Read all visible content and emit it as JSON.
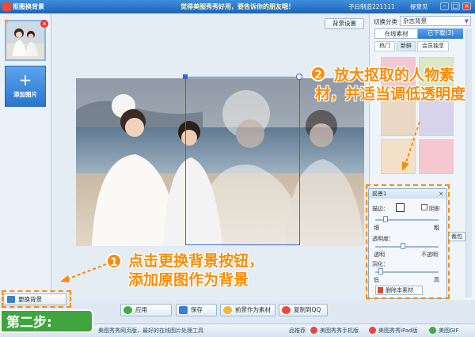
{
  "window": {
    "title": "抠图换背景",
    "slogan": "觉得美图秀秀好用，要告诉你的朋友哦！",
    "user": "子曰制造221111",
    "tip": "提意见",
    "controls": {
      "minimize": "–",
      "maximize": "□",
      "close": "×"
    }
  },
  "left_panel": {
    "add_label": "添加图片",
    "add_plus": "+",
    "thumb_close": "×",
    "thumb_star": "★"
  },
  "canvas": {
    "bg_settings_label": "背景设置"
  },
  "right_panel": {
    "category_label": "切换分类",
    "category_value": "杂志背景",
    "category_arrow": "▼",
    "tabs": [
      "在线素材",
      "已下载(3)"
    ],
    "subtabs": [
      "热门",
      "新鲜",
      "会员独享"
    ]
  },
  "layer_dialog": {
    "title": "前景1",
    "close": "×",
    "stroke_label": "描边：",
    "shadow_label": "阴影",
    "thin": "细",
    "thick": "粗",
    "opacity_label": "透明度：",
    "transparent": "透明",
    "opaque": "不透明",
    "feather": "羽化：",
    "low": "低",
    "high": "高",
    "delete_label": "删除本素材",
    "side_label": "裁包"
  },
  "bottom_buttons": {
    "bg_change": "更换背景",
    "apply": "应用",
    "save": "保存",
    "fg_as_material": "前景作为素材",
    "copy_to_qq": "复制到QQ"
  },
  "footer": {
    "left_text": "美图秀秀网页版，最好的在线图片处理工具",
    "recommend": "品推荐",
    "phone": "美图秀秀手机版",
    "ipad": "美图秀秀iPad版",
    "gif": "美图GIF"
  },
  "annotations": {
    "step2_num": "2",
    "step2_text": "放大抠取的人物素材，并适当调低透明度",
    "step1_num": "1",
    "step1_line1": "点击更换背景按钮，",
    "step1_line2": "添加原图作为背景",
    "step_label": "第二步:"
  },
  "colors": {
    "accent": "#ff8a00",
    "title_bar": "#1c63b8",
    "step_green": "#3fa63f",
    "selection": "#3a62e0"
  }
}
